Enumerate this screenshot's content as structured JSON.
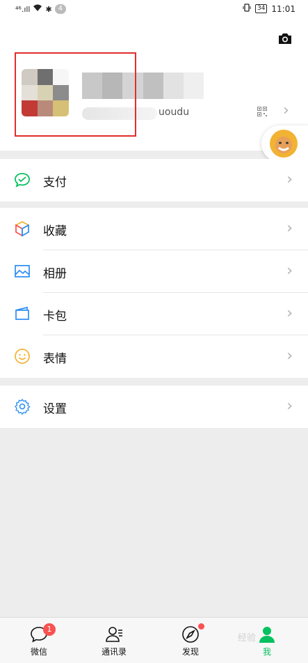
{
  "status_bar": {
    "network": "⁴⁶.ıll",
    "notification_count": "4",
    "battery": "34",
    "time": "11:01"
  },
  "profile": {
    "wechat_id_suffix": "uoudu"
  },
  "menu": {
    "pay": "支付",
    "favorites": "收藏",
    "album": "相册",
    "cards": "卡包",
    "stickers": "表情",
    "settings": "设置"
  },
  "tabs": [
    {
      "label": "微信",
      "badge": "1"
    },
    {
      "label": "通讯录"
    },
    {
      "label": "发现"
    },
    {
      "label": "我"
    }
  ],
  "watermark": "经验"
}
